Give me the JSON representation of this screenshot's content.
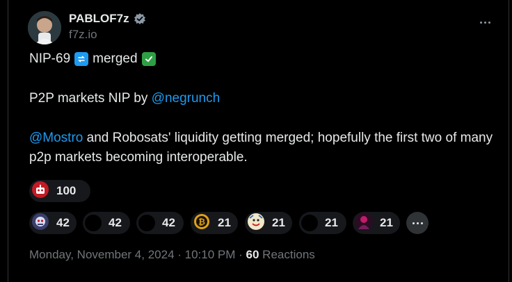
{
  "author": {
    "name": "PABLOF7z",
    "handle": "f7z.io",
    "verified_icon": "verified-badge-icon",
    "avatar_icon": "user-avatar"
  },
  "post": {
    "line1_prefix": "NIP-69",
    "line1_emoji_repeat": "🔁",
    "line1_word": "merged",
    "line1_emoji_check": "✅",
    "line2_text": "P2P markets NIP by ",
    "line2_link": "@negrunch",
    "line3_link": "@Mostro",
    "line3_text": " and Robosats' liquidity getting merged; hopefully the first two of many p2p markets becoming interoperable."
  },
  "reactions": {
    "big": {
      "count": "100",
      "icon": "robot-emoji-icon"
    },
    "small": [
      {
        "count": "42",
        "icon": "robot-face-emoji-icon"
      },
      {
        "count": "42",
        "icon": "black-circle-emoji-icon"
      },
      {
        "count": "42",
        "icon": "black-circle-emoji-icon"
      },
      {
        "count": "21",
        "icon": "bitcoin-coin-emoji-icon"
      },
      {
        "count": "21",
        "icon": "smiling-character-emoji-icon"
      },
      {
        "count": "21",
        "icon": "black-circle-emoji-icon"
      },
      {
        "count": "21",
        "icon": "person-emoji-icon"
      }
    ]
  },
  "meta": {
    "date": "Monday, November 4, 2024",
    "time": "10:10 PM",
    "separator": " · ",
    "reactions_count": "60",
    "reactions_label": "Reactions"
  },
  "colors": {
    "link": "#1d9bf0",
    "text": "#e7e9ea",
    "muted": "#71767b",
    "pill": "#16181c"
  }
}
